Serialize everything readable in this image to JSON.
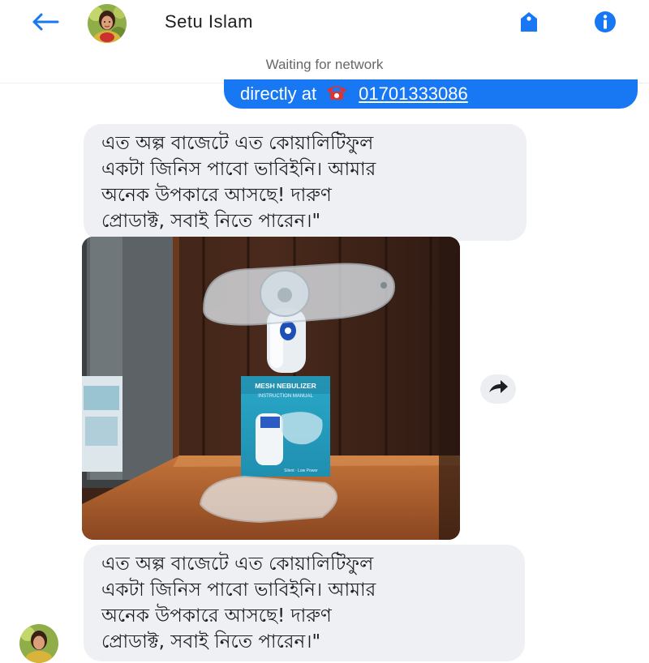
{
  "header": {
    "contact_name": "Setu Islam",
    "back_icon": "arrow-left-icon",
    "right_icons": [
      "tag-icon",
      "info-icon"
    ],
    "accent_color": "#1877f2"
  },
  "status": {
    "text": "Waiting for network"
  },
  "sent_message": {
    "text": "directly at",
    "phone_icon": "telephone-icon",
    "phone": "01701333086"
  },
  "received_messages": [
    {
      "lines": [
        "এত অল্প বাজেটে এত কোয়ালিটিফুল",
        "একটা জিনিস পাবো ভাবিইনি। আমার",
        "অনেক উপকারে আসছে! দারুণ",
        "প্রোডাক্ট, সবাই নিতে পারেন।\""
      ]
    },
    {
      "lines": [
        "এত অল্প বাজেটে এত কোয়ালিটিফুল",
        "একটা জিনিস পাবো ভাবিইনি। আমার",
        "অনেক উপকারে আসছে! দারুণ",
        "প্রোডাক্ট, সবাই নিতে পারেন।\""
      ]
    }
  ],
  "photo": {
    "box_title": "MESH NEBULIZER",
    "box_subtitle": "INSTRUCTION MANUAL",
    "box_tagline": "Silent · Low Power"
  },
  "forward_icon": "forward-arrow-icon"
}
